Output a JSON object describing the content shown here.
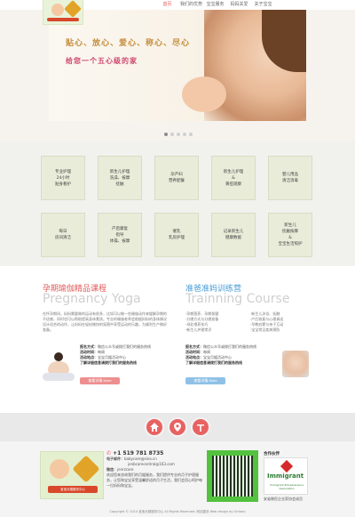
{
  "nav": {
    "items": [
      "首页",
      "我们的优势",
      "宝宝服务",
      "妈妈关爱",
      "关于宝宝"
    ]
  },
  "banner": {
    "slogan_line1": "贴心、放心、爱心、称心、尽心",
    "slogan_line2": "给您一个五心级的家",
    "slide_count": 5,
    "active_slide": 0
  },
  "services": [
    [
      "专业护理",
      "24小时",
      "贴身看护"
    ],
    [
      "新生儿护理",
      "洗澡、按摩",
      "抚触"
    ],
    [
      "孕产妇",
      "营养配餐"
    ],
    [
      "新生儿护理",
      "&",
      "黄疸观察"
    ],
    [
      "婴儿用品",
      "清洁消毒"
    ],
    [
      "每日",
      "房间清洁"
    ],
    [
      "产后康复",
      "指导",
      "体操、按摩"
    ],
    [
      "催乳",
      "乳房护理"
    ],
    [
      "记录新生儿",
      "健康数据"
    ],
    [
      "新生儿",
      "抚触按摩",
      "&",
      "宝宝生活照护"
    ]
  ],
  "yoga": {
    "title_cn": "孕期瑜伽精品课程",
    "title_en": "Pregnancy Yoga",
    "description": "在怀孕期间，妈妈需要做的运动有很多，比如可以做一些瑜伽动作来缓解孕期的不适感，同时也可以帮助提高身体素质。专业的瑜伽老师会根据妈妈的身体情况设计适合的动作，让妈妈在轻松愉快的氛围中享受运动的乐趣，为顺利生产做好准备。",
    "info_label1": "报名方式：",
    "info_value1": "微信公众号或拨打我们的服务热线",
    "info_label2": "活动时间：",
    "info_value2": "每周",
    "info_label3": "活动地点：",
    "info_value3": "宝宝月嫂活动中心",
    "info_note": "了解详细信息请拨打我们的服务热线",
    "button": "查看详情 More"
  },
  "training": {
    "title_cn": "准爸准妈训练营",
    "title_en": "Trainning Course",
    "col1": [
      "·孕期营养、孕期保健",
      "·分娩方式与分娩准备",
      "·母乳喂养技巧",
      "·新生儿护理常识"
    ],
    "col2": [
      "·新生儿沐浴、抚触",
      "·产后恢复与心理调适",
      "·早教启蒙与亲子互动",
      "·宝宝常见疾病预防"
    ],
    "info_label1": "报名方式：",
    "info_value1": "微信公众号或拨打我们的服务热线",
    "info_label2": "活动时间：",
    "info_value2": "每周",
    "info_label3": "活动地点：",
    "info_value3": "宝宝月嫂活动中心",
    "info_note": "了解详细信息请拨打我们的服务热线",
    "button": "查看详情 More"
  },
  "footer": {
    "icons": [
      "home-icon",
      "location-icon",
      "top-icon"
    ],
    "logo_text": "宝宝月嫂服务中心",
    "phone": "+1 519 781 8735",
    "email_label": "电子邮件：",
    "email1": "babycare@sina.cn",
    "email2": "jenbcarecentral@163.com",
    "wechat_label": "微信：",
    "wechat": "jenrzcare",
    "blurb": "欢迎您来咨询我们的月嫂服务，我们提供专业的月子护理服务，让您和宝宝享受温馨舒适的月子生活，我们会用心呵护每一位妈妈和宝宝。",
    "cert_title": "合作伙伴",
    "cert_brand": "Immigrant",
    "cert_sub": "Immigrant Entrepreneurs Association",
    "cert_caption": "安省移民企业家协会成员",
    "copyright": "Copyright © 2014 宝宝月嫂服务中心 All Rights Reserved. 网站建设 Web design by Ontario"
  },
  "colors": {
    "accent": "#e86262",
    "yoga_title": "#e15b5b",
    "training_title": "#4a9cd6",
    "service_tile": "#e8ecd8",
    "button_red": "#ee8f8f",
    "button_blue": "#8fc1e6"
  }
}
